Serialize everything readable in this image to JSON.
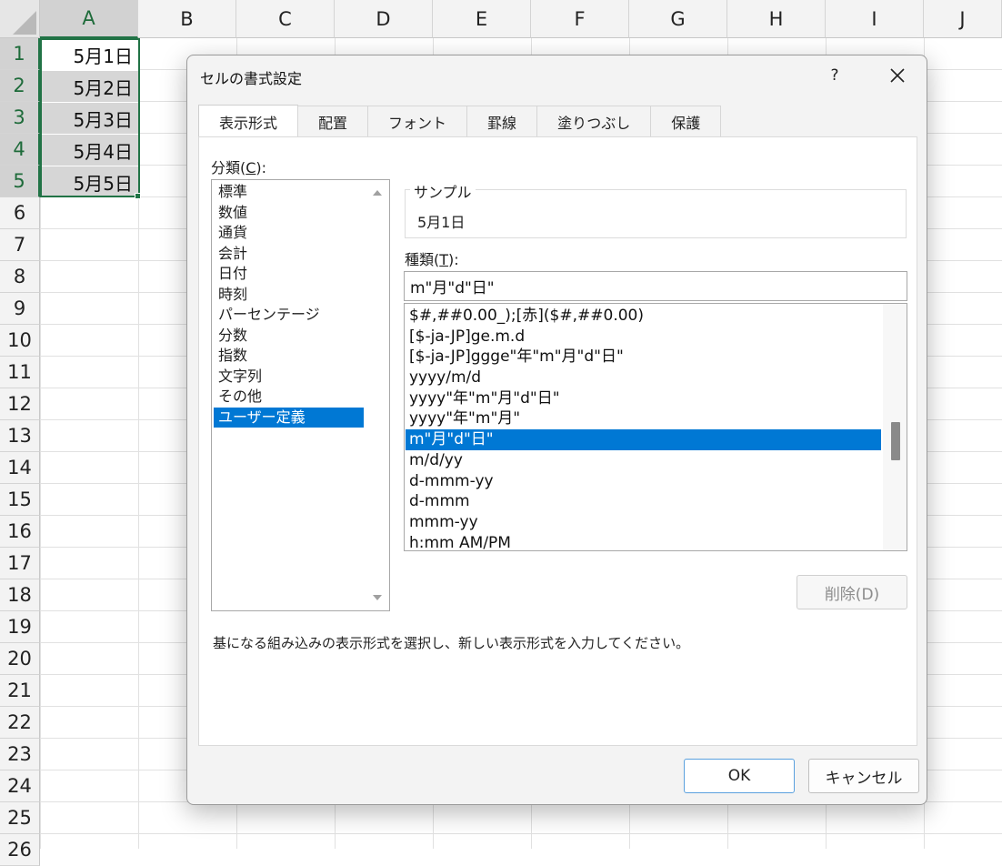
{
  "spreadsheet": {
    "columns": [
      "A",
      "B",
      "C",
      "D",
      "E",
      "F",
      "G",
      "H",
      "I",
      "J"
    ],
    "rows": [
      "1",
      "2",
      "3",
      "4",
      "5",
      "6",
      "7",
      "8",
      "9",
      "10",
      "11",
      "12",
      "13",
      "14",
      "15",
      "16",
      "17",
      "18",
      "19",
      "20",
      "21",
      "22",
      "23",
      "24",
      "25",
      "26"
    ],
    "cells_A": [
      "5月1日",
      "5月2日",
      "5月3日",
      "5月4日",
      "5月5日"
    ],
    "colors": {
      "selection": "#217346",
      "selected_fill": "#d6d6d6"
    }
  },
  "dialog": {
    "title": "セルの書式設定",
    "help": "?",
    "tabs": [
      "表示形式",
      "配置",
      "フォント",
      "罫線",
      "塗りつぶし",
      "保護"
    ],
    "active_tab": "表示形式",
    "category_label_prefix": "分類(",
    "category_label_key": "C",
    "category_label_suffix": "):",
    "categories": [
      "標準",
      "数値",
      "通貨",
      "会計",
      "日付",
      "時刻",
      "パーセンテージ",
      "分数",
      "指数",
      "文字列",
      "その他",
      "ユーザー定義"
    ],
    "selected_category": "ユーザー定義",
    "sample_label": "サンプル",
    "sample_value": "5月1日",
    "type_label_prefix": "種類(",
    "type_label_key": "T",
    "type_label_suffix": "):",
    "type_value": "m\"月\"d\"日\"",
    "formats": [
      "$#,##0.00_);[赤]($#,##0.00)",
      "[$-ja-JP]ge.m.d",
      "[$-ja-JP]ggge\"年\"m\"月\"d\"日\"",
      "yyyy/m/d",
      "yyyy\"年\"m\"月\"d\"日\"",
      "yyyy\"年\"m\"月\"",
      "m\"月\"d\"日\"",
      "m/d/yy",
      "d-mmm-yy",
      "d-mmm",
      "mmm-yy",
      "h:mm AM/PM"
    ],
    "selected_format": "m\"月\"d\"日\"",
    "delete_button": "削除(D)",
    "hint": "基になる組み込みの表示形式を選択し、新しい表示形式を入力してください。",
    "ok_button": "OK",
    "cancel_button": "キャンセル",
    "colors": {
      "selection": "#0078d4"
    },
    "icons": {
      "close": "close-icon",
      "scroll_up": "chevron-up-icon",
      "scroll_down": "chevron-down-icon"
    }
  }
}
